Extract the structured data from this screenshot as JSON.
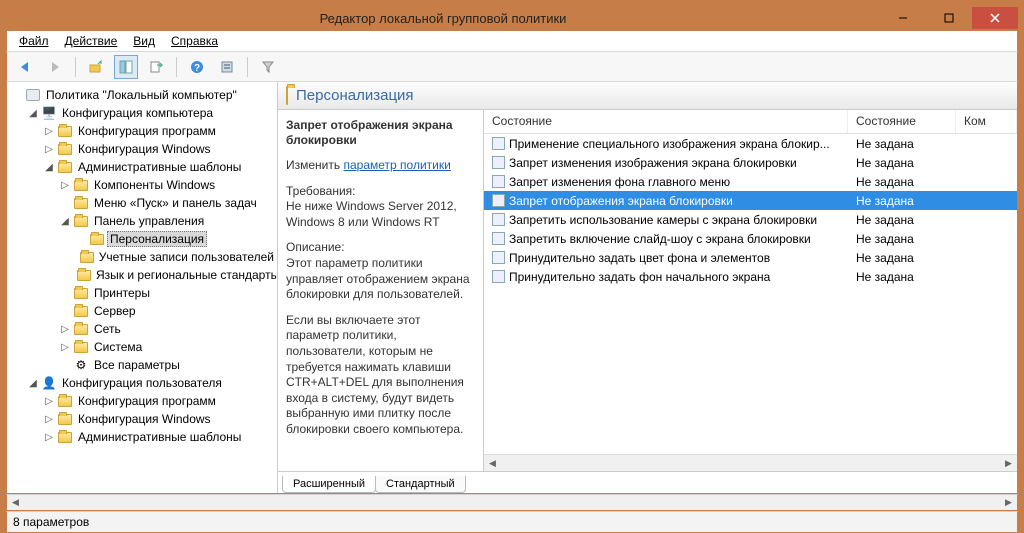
{
  "title": "Редактор локальной групповой политики",
  "menu": {
    "file": "Файл",
    "action": "Действие",
    "view": "Вид",
    "help": "Справка"
  },
  "tree": {
    "root": "Политика \"Локальный компьютер\"",
    "comp_conf": "Конфигурация компьютера",
    "soft_conf": "Конфигурация программ",
    "win_conf": "Конфигурация Windows",
    "admin_tpl": "Административные шаблоны",
    "win_comp": "Компоненты Windows",
    "start_menu": "Меню «Пуск» и панель задач",
    "ctrl_panel": "Панель управления",
    "personalization": "Персонализация",
    "user_accounts": "Учетные записи пользователей",
    "lang_region": "Язык и региональные стандарты",
    "printers": "Принтеры",
    "server": "Сервер",
    "network": "Сеть",
    "system": "Система",
    "all_params": "Все параметры",
    "user_conf": "Конфигурация пользователя",
    "u_soft_conf": "Конфигурация программ",
    "u_win_conf": "Конфигурация Windows",
    "u_admin_tpl": "Административные шаблоны"
  },
  "header": "Персонализация",
  "details": {
    "name": "Запрет отображения экрана блокировки",
    "edit_prefix": "Изменить",
    "edit_link": "параметр политики",
    "req_label": "Требования:",
    "req_text": "Не ниже Windows Server 2012, Windows 8 или Windows RT",
    "desc_label": "Описание:",
    "desc_p1": "Этот параметр политики управляет отображением экрана блокировки для пользователей.",
    "desc_p2": "Если вы включаете этот параметр политики, пользователи, которым не требуется нажимать клавиши CTR+ALT+DEL для выполнения входа в систему, будут видеть выбранную ими плитку после блокировки своего компьютера."
  },
  "columns": {
    "state_hdr1": "Состояние",
    "state_hdr2": "Состояние",
    "comment": "Ком"
  },
  "rows": [
    {
      "name": "Применение специального изображения экрана блокир...",
      "state": "Не задана",
      "selected": false
    },
    {
      "name": "Запрет изменения изображения экрана блокировки",
      "state": "Не задана",
      "selected": false
    },
    {
      "name": "Запрет изменения фона главного меню",
      "state": "Не задана",
      "selected": false
    },
    {
      "name": "Запрет отображения экрана блокировки",
      "state": "Не задана",
      "selected": true
    },
    {
      "name": "Запретить использование камеры с экрана блокировки",
      "state": "Не задана",
      "selected": false
    },
    {
      "name": "Запретить включение слайд-шоу с экрана блокировки",
      "state": "Не задана",
      "selected": false
    },
    {
      "name": "Принудительно задать цвет фона и элементов",
      "state": "Не задана",
      "selected": false
    },
    {
      "name": "Принудительно задать фон начального экрана",
      "state": "Не задана",
      "selected": false
    }
  ],
  "tabs": {
    "ext": "Расширенный",
    "std": "Стандартный"
  },
  "status": "8 параметров"
}
